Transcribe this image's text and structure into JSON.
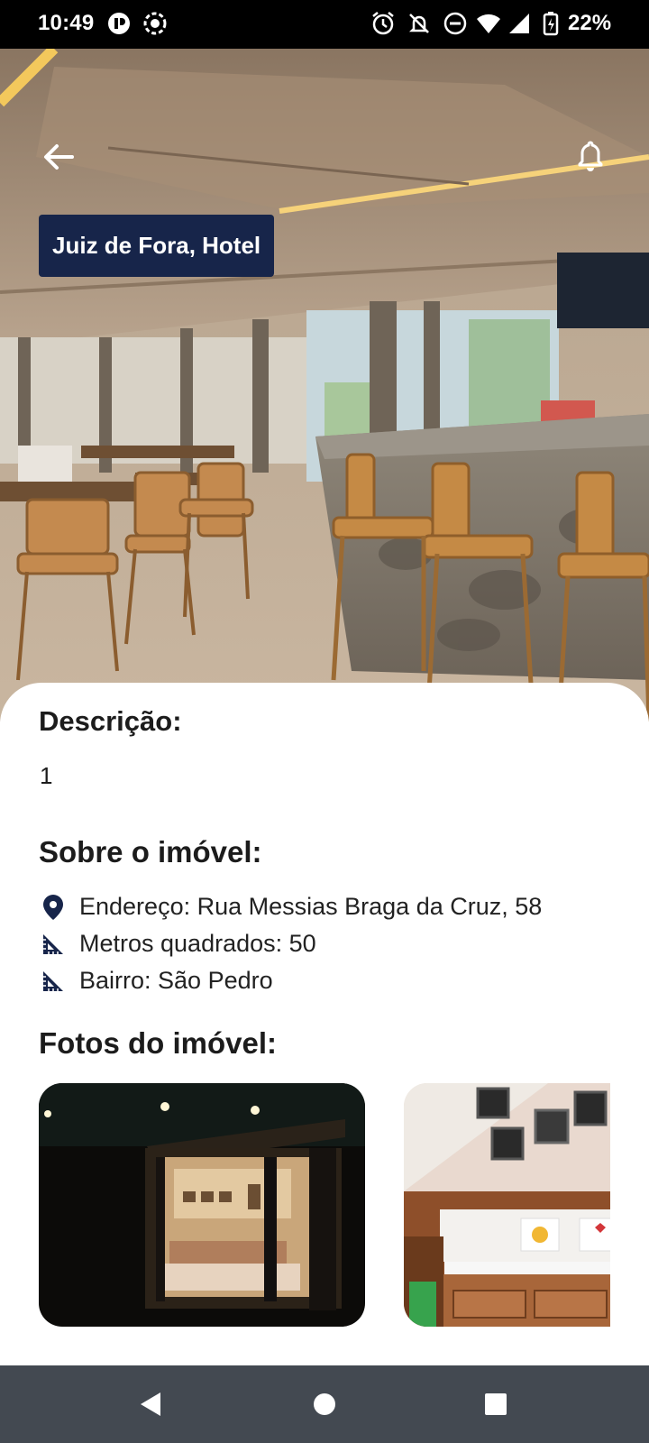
{
  "status_bar": {
    "time": "10:49",
    "battery": "22%",
    "icons": [
      "app-notification-icon",
      "screen-record-icon",
      "alarm-icon",
      "mute-icon",
      "do-not-disturb-icon",
      "wifi-icon",
      "signal-icon",
      "battery-charging-icon"
    ]
  },
  "header": {
    "back_icon": "arrow-left-icon",
    "notifications_icon": "bell-icon",
    "title": "Juiz de Fora, Hotel"
  },
  "details": {
    "description_heading": "Descrição:",
    "description_value": "1",
    "about_heading": "Sobre o imóvel:",
    "address_label": "Endereço:  Rua Messias Braga da Cruz, 58",
    "area_label": "Metros quadrados: 50",
    "district_label": "Bairro: São Pedro",
    "photos_heading": "Fotos do imóvel:"
  },
  "navigation": {
    "back": "triangle-back-icon",
    "home": "circle-home-icon",
    "recents": "square-recents-icon"
  },
  "colors": {
    "badge_bg": "#17254a",
    "nav_bg": "#434951",
    "icon_dark": "#17254a"
  }
}
